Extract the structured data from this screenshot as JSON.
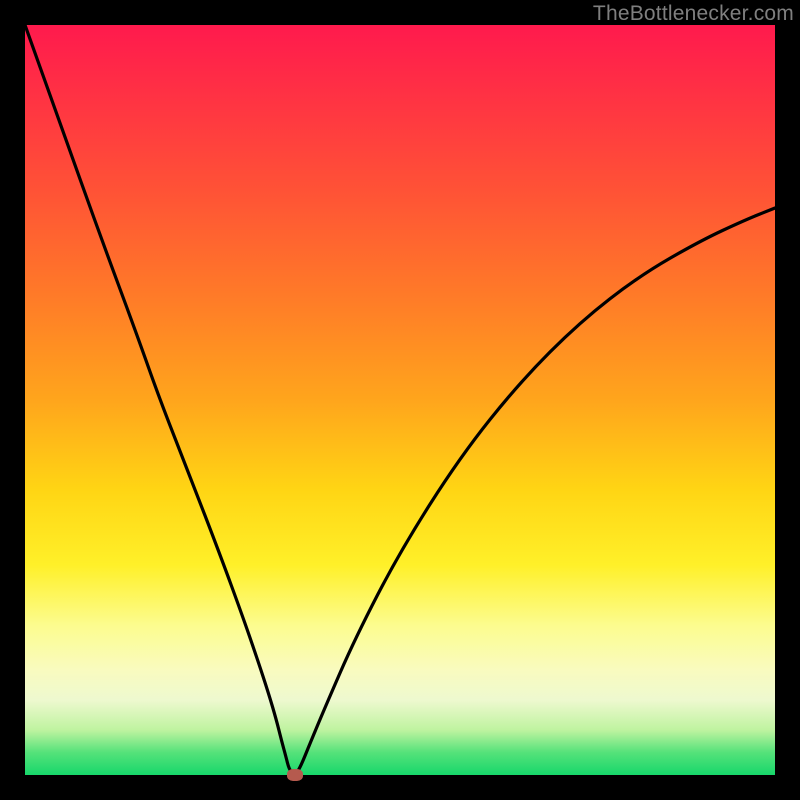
{
  "watermark": {
    "text": "TheBottlenecker.com"
  },
  "chart_data": {
    "type": "line",
    "title": "",
    "xlabel": "",
    "ylabel": "",
    "xlim": [
      0,
      100
    ],
    "ylim": [
      0,
      100
    ],
    "grid": false,
    "series": [
      {
        "name": "bottleneck-curve",
        "x": [
          0,
          5,
          10,
          15,
          18,
          22,
          26,
          29,
          31,
          32.5,
          33.5,
          34.2,
          34.8,
          35.2,
          35.8,
          36,
          36,
          36.7,
          38,
          40,
          44,
          50,
          58,
          66,
          74,
          82,
          90,
          96,
          100
        ],
        "values": [
          100,
          86,
          72,
          58.5,
          50,
          39.8,
          29.4,
          21.2,
          15.4,
          10.8,
          7.4,
          4.6,
          2.4,
          0.8,
          0.1,
          0,
          0,
          1.0,
          4.2,
          9.0,
          18.2,
          29.8,
          42.4,
          52.4,
          60.4,
          66.6,
          71.2,
          74.0,
          75.6
        ]
      }
    ],
    "marker": {
      "name": "optimal-point",
      "x": 36,
      "y": 0
    },
    "background_gradient": {
      "stops": [
        {
          "pos": 0,
          "color": "#ff1a4d"
        },
        {
          "pos": 22,
          "color": "#ff5236"
        },
        {
          "pos": 50,
          "color": "#ffa51c"
        },
        {
          "pos": 72,
          "color": "#fff029"
        },
        {
          "pos": 90,
          "color": "#eef9cf"
        },
        {
          "pos": 100,
          "color": "#17d76b"
        }
      ]
    }
  }
}
